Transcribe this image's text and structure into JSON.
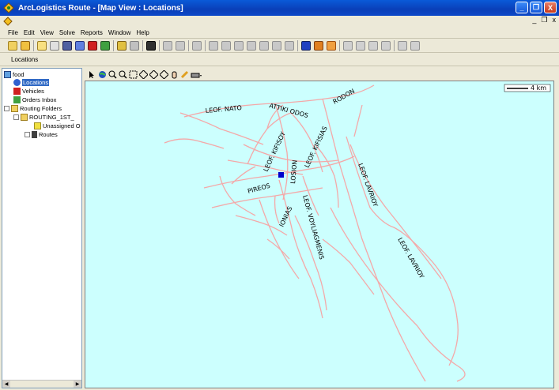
{
  "window": {
    "title": "ArcLogistics Route - [Map View : Locations]",
    "controls": {
      "minimize": "_",
      "maximize": "❐",
      "close": "X"
    },
    "mdi_controls": {
      "minimize": "_",
      "restore": "❐",
      "close": "x"
    }
  },
  "menu": [
    "File",
    "Edit",
    "View",
    "Solve",
    "Reports",
    "Window",
    "Help"
  ],
  "location_bar": {
    "label": "Locations"
  },
  "tree": {
    "root": "food",
    "items": [
      {
        "label": "Locations",
        "selected": true
      },
      {
        "label": "Vehicles"
      },
      {
        "label": "Orders Inbox"
      },
      {
        "label": "Routing Folders"
      },
      {
        "label": "ROUTING_1ST_"
      },
      {
        "label": "Unassigned O"
      },
      {
        "label": "Routes"
      }
    ]
  },
  "map": {
    "scale_label": "4 km",
    "road_labels": [
      "LEOF. NATO",
      "ATTIKI ODOS",
      "RODON",
      "LEOF. KIFISIAS",
      "LEOF. KIFISOY",
      "LOSION",
      "PIREOS",
      "LEOF. LAVRIOY",
      "IONIAS",
      "LEOF. VOYLIAGMENIS",
      "LEOF. LAVRIOY"
    ],
    "road_color": "#f4a8a8",
    "water_color": "#ccfffe",
    "marker_color": "#0000cc"
  }
}
